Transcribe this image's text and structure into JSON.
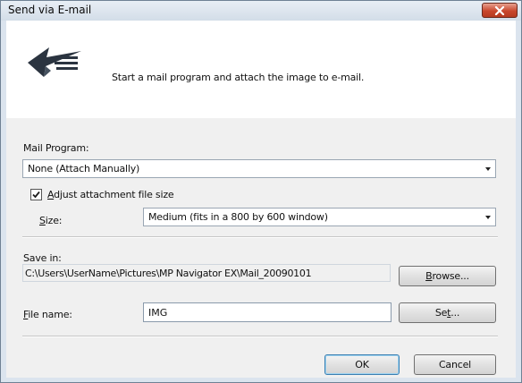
{
  "window": {
    "title": "Send via E-mail"
  },
  "header": {
    "icon": "mail-send-icon",
    "text": "Start a mail program and attach the image to e-mail."
  },
  "mail_program": {
    "label": "Mail Program:",
    "selected": "None (Attach Manually)"
  },
  "adjust": {
    "checked": true,
    "label_mnemonic": "A",
    "label_rest": "djust attachment file size"
  },
  "size": {
    "label_mnemonic": "S",
    "label_rest": "ize:",
    "selected": "Medium (fits in a 800 by 600 window)"
  },
  "save_in": {
    "label": "Save in:",
    "path": "C:\\Users\\UserName\\Pictures\\MP Navigator EX\\Mail_20090101",
    "browse_mnemonic": "B",
    "browse_rest": "rowse..."
  },
  "file_name": {
    "label_mnemonic": "F",
    "label_rest": "ile name:",
    "value": "IMG",
    "set_pre": "Se",
    "set_mnemonic": "t",
    "set_post": "..."
  },
  "buttons": {
    "ok": "OK",
    "cancel": "Cancel"
  }
}
